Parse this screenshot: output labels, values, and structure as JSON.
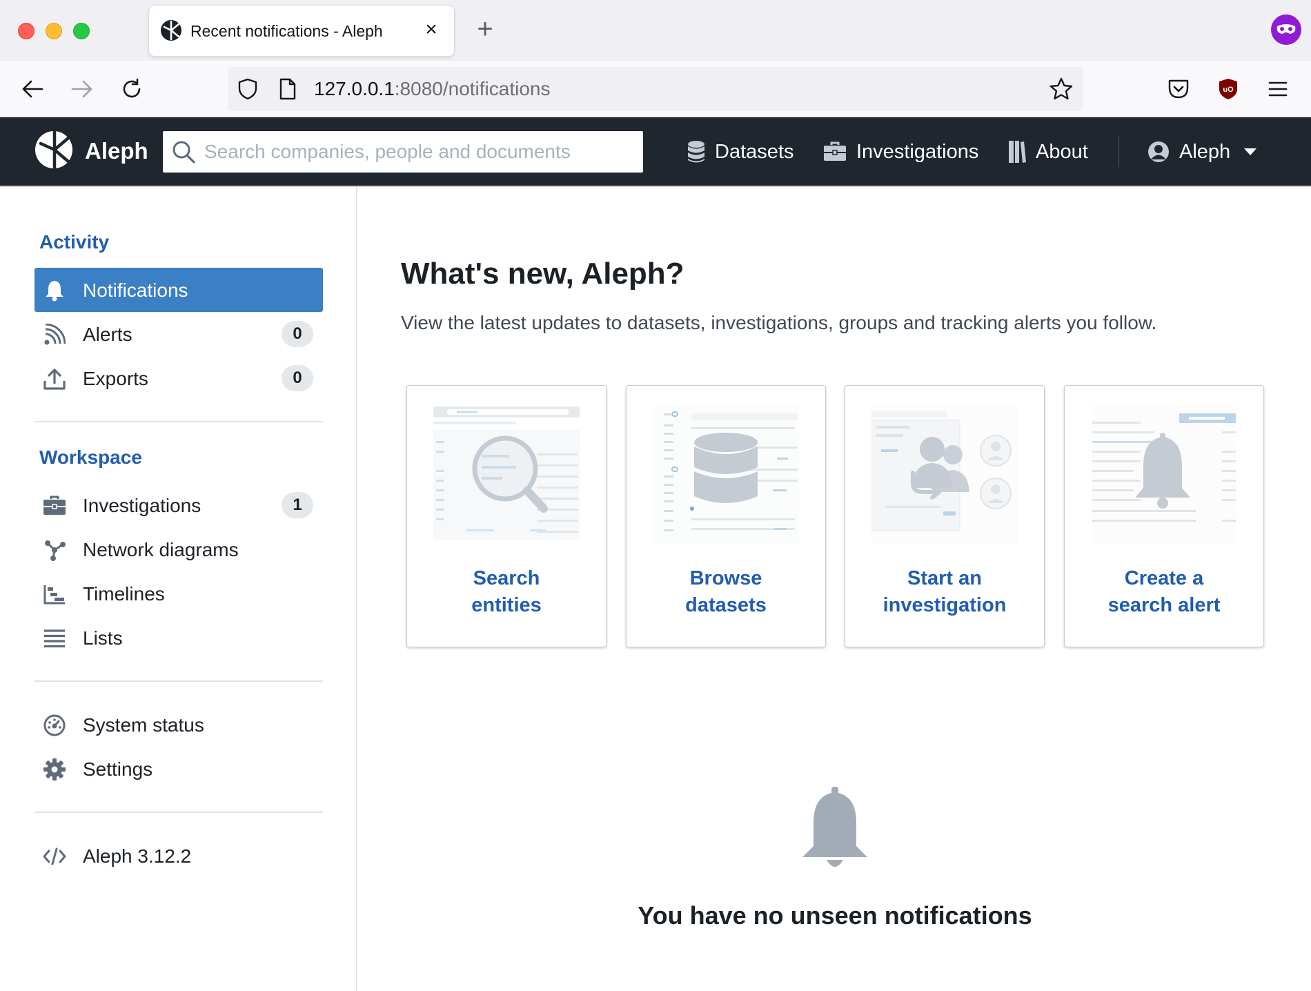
{
  "browser": {
    "tab_title": "Recent notifications - Aleph",
    "url_host": "127.0.0.1",
    "url_rest": ":8080/notifications"
  },
  "header": {
    "app_name": "Aleph",
    "search_placeholder": "Search companies, people and documents",
    "nav": {
      "datasets": "Datasets",
      "investigations": "Investigations",
      "about": "About",
      "user": "Aleph"
    }
  },
  "sidebar": {
    "activity_title": "Activity",
    "workspace_title": "Workspace",
    "activity_items": [
      {
        "label": "Notifications",
        "icon": "bell-icon",
        "active": true
      },
      {
        "label": "Alerts",
        "icon": "rss-icon",
        "count": "0"
      },
      {
        "label": "Exports",
        "icon": "upload-icon",
        "count": "0"
      }
    ],
    "workspace_items": [
      {
        "label": "Investigations",
        "icon": "briefcase-icon",
        "count": "1"
      },
      {
        "label": "Network diagrams",
        "icon": "graph-icon"
      },
      {
        "label": "Timelines",
        "icon": "timeline-icon"
      },
      {
        "label": "Lists",
        "icon": "list-icon"
      }
    ],
    "system_items": [
      {
        "label": "System status",
        "icon": "dashboard-icon"
      },
      {
        "label": "Settings",
        "icon": "gear-icon"
      }
    ],
    "version": "Aleph 3.12.2"
  },
  "main": {
    "title": "What's new, Aleph?",
    "description": "View the latest updates to datasets, investigations, groups and tracking alerts you follow.",
    "cards": [
      {
        "line1": "Search",
        "line2": "entities"
      },
      {
        "line1": "Browse",
        "line2": "datasets"
      },
      {
        "line1": "Start an",
        "line2": "investigation"
      },
      {
        "line1": "Create a",
        "line2": "search alert"
      }
    ],
    "empty_message": "You have no unseen notifications"
  },
  "colors": {
    "accent": "#215db0",
    "active_item": "#3b7fc4",
    "header_bg": "#1f262e"
  }
}
